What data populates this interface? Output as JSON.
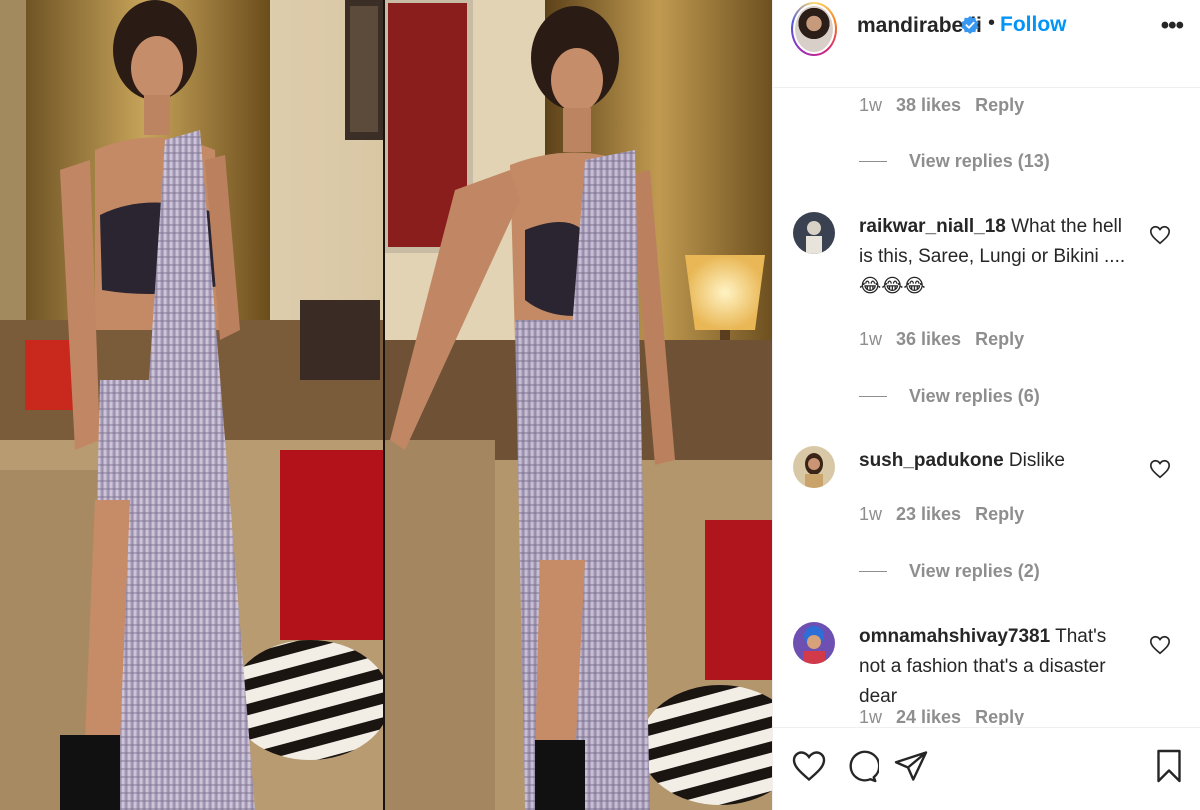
{
  "post": {
    "username": "mandirabedi",
    "follow_label": "Follow",
    "separator": "•",
    "more_label": "•••"
  },
  "thread": {
    "top_meta": {
      "time": "1w",
      "likes": "38 likes",
      "reply": "Reply"
    },
    "top_view_replies": "View replies (13)",
    "comments": [
      {
        "username": "raikwar_niall_18",
        "text": " What the hell is this, Saree, Lungi or Bikini ....😂😂😂",
        "time": "1w",
        "likes": "36 likes",
        "reply": "Reply",
        "view_replies": "View replies (6)"
      },
      {
        "username": "sush_padukone",
        "text": " Dislike",
        "time": "1w",
        "likes": "23 likes",
        "reply": "Reply",
        "view_replies": "View replies (2)"
      },
      {
        "username": "omnamahshivay7381",
        "text": " That's not a fashion that's a disaster dear",
        "time": "1w",
        "likes": "24 likes",
        "reply": "Reply"
      }
    ]
  },
  "icons": {
    "verified": "verified-badge-icon",
    "like": "heart-icon",
    "comment": "comment-icon",
    "share": "share-icon",
    "save": "bookmark-icon",
    "more": "more-options-icon"
  },
  "colors": {
    "accent": "#0095f6",
    "muted": "#8e8e8e",
    "text": "#262626"
  }
}
